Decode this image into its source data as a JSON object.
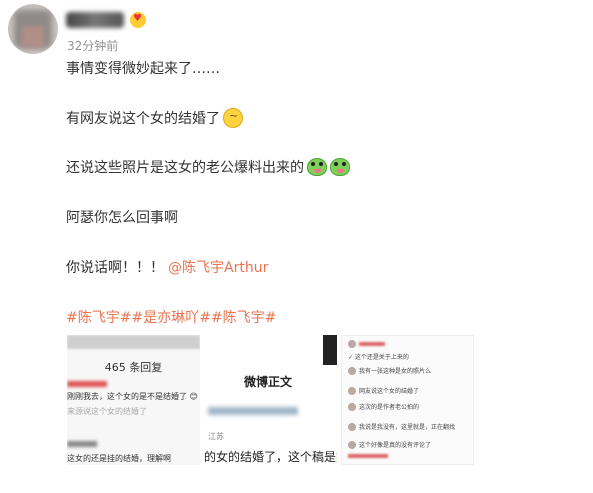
{
  "post": {
    "time": "32分钟前",
    "lines": [
      "事情变得微妙起来了……",
      "有网友说这个女的结婚了",
      "还说这些照片是这女的老公爆料出来的",
      "阿瑟你怎么回事啊",
      "你说话啊！！！"
    ],
    "mention": "@陈飞宇Arthur",
    "topics": "#陈飞宇##是亦琳吖##陈飞宇#"
  },
  "images": {
    "img1": {
      "header": "465 条回复",
      "row1": "刚刚我去，这个女的是不是结婚了 😊",
      "row2": "来源说这个女的结婚了",
      "row3": "这女的还是挂的结婚，理解啊"
    },
    "img2": {
      "title": "微博正文",
      "small": "江苏",
      "big": "的女的结婚了，这个稿是她老公"
    },
    "img3": {
      "rows": [
        "✓ 这个还是关于上来的",
        "我有一张这种是女的照片么",
        "网友说这个女的结婚了",
        "这次的是作者老公拍的",
        "我说是我没有，这里就是，正在翻找",
        "这个好像是真的没有评论了"
      ]
    }
  }
}
